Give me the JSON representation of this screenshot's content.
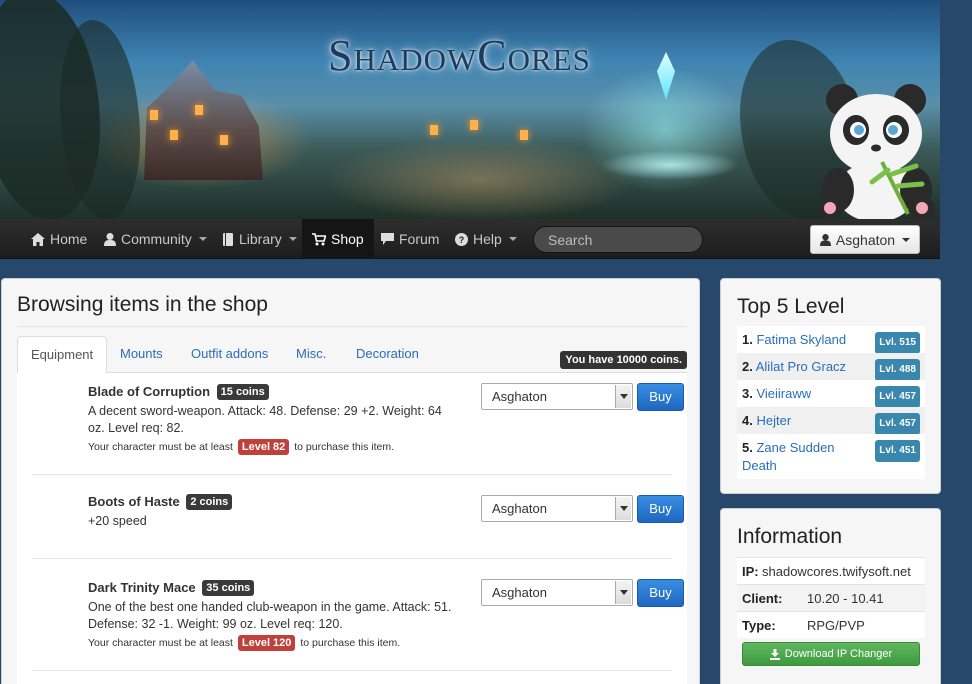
{
  "site": {
    "logo_text": "ShadowCores"
  },
  "nav": {
    "home": "Home",
    "community": "Community",
    "library": "Library",
    "shop": "Shop",
    "forum": "Forum",
    "help": "Help",
    "search_placeholder": "Search",
    "user": "Asghaton"
  },
  "shop": {
    "title": "Browsing items in the shop",
    "tabs": [
      "Equipment",
      "Mounts",
      "Outfit addons",
      "Misc.",
      "Decoration"
    ],
    "active_tab": "Equipment",
    "coins_notice": "You have 10000 coins.",
    "buy_label": "Buy",
    "selected_character": "Asghaton",
    "req_prefix": "Your character must be at least",
    "req_suffix": "to purchase this item.",
    "items": [
      {
        "name": "Blade of Corruption",
        "price": "15 coins",
        "description": "A decent sword-weapon. Attack: 48. Defense: 29 +2. Weight: 64 oz. Level req: 82.",
        "level": "Level 82"
      },
      {
        "name": "Boots of Haste",
        "price": "2 coins",
        "description": "+20 speed",
        "level": null
      },
      {
        "name": "Dark Trinity Mace",
        "price": "35 coins",
        "description": "One of the best one handed club-weapon in the game. Attack: 51. Defense: 32 -1. Weight: 99 oz. Level req: 120.",
        "level": "Level 120"
      }
    ]
  },
  "top_level": {
    "title": "Top 5 Level",
    "players": [
      {
        "rank": "1.",
        "name": "Fatima Skyland",
        "level": "Lvl. 515"
      },
      {
        "rank": "2.",
        "name": "Alilat Pro Gracz",
        "level": "Lvl. 488"
      },
      {
        "rank": "3.",
        "name": "Vieiiraww",
        "level": "Lvl. 457"
      },
      {
        "rank": "4.",
        "name": "Hejter",
        "level": "Lvl. 457"
      },
      {
        "rank": "5.",
        "name": "Zane Sudden Death",
        "level": "Lvl. 451"
      }
    ]
  },
  "information": {
    "title": "Information",
    "ip_label": "IP:",
    "ip_value": "shadowcores.twifysoft.net",
    "client_label": "Client:",
    "client_value": "10.20 - 10.41",
    "type_label": "Type:",
    "type_value": "RPG/PVP",
    "download_label": "Download IP Changer"
  },
  "colors": {
    "page_bg": "#27486b",
    "nav_bg": "#1d1d1d",
    "link": "#2a6ebb",
    "buy": "#1f67c2",
    "level_badge": "#c0413b",
    "player_level_badge": "#3a87ad",
    "download": "#3f9a3f"
  },
  "icons": [
    "home-icon",
    "user-icon",
    "book-icon",
    "cart-icon",
    "comment-icon",
    "question-icon",
    "download-icon"
  ]
}
